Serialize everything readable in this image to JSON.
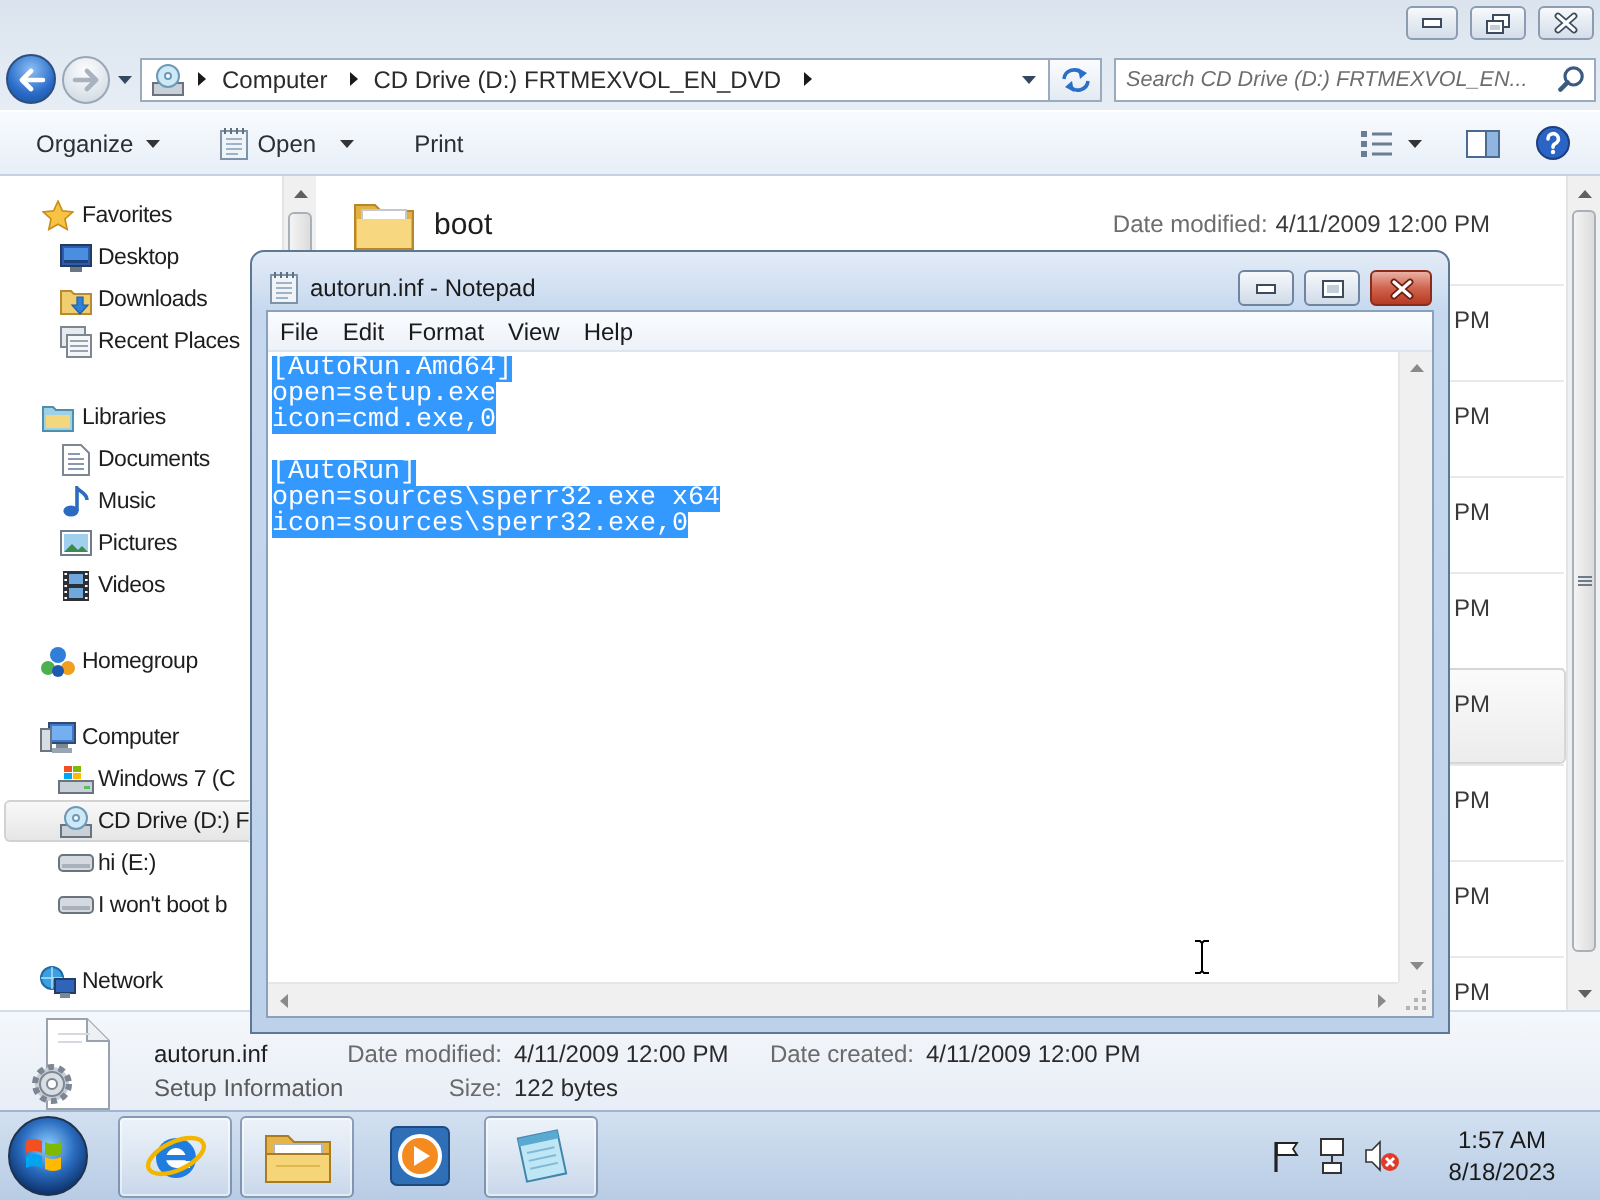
{
  "explorer": {
    "history": {
      "back_disabled": false,
      "forward_disabled": true
    },
    "breadcrumbs": [
      "Computer",
      "CD Drive (D:) FRTMEXVOL_EN_DVD"
    ],
    "search": {
      "placeholder": "Search CD Drive (D:) FRTMEXVOL_EN..."
    },
    "toolbar": [
      {
        "label": "Organize",
        "kind": "menu"
      },
      {
        "label": "Open",
        "kind": "icon-menu"
      },
      {
        "label": "Print",
        "kind": "command"
      }
    ],
    "nav_pane": [
      {
        "label": "Favorites",
        "selected": false,
        "children": [
          {
            "label": "Desktop",
            "selected": false
          },
          {
            "label": "Downloads",
            "selected": false
          },
          {
            "label": "Recent Places",
            "selected": false
          }
        ]
      },
      {
        "label": "Libraries",
        "selected": false,
        "children": [
          {
            "label": "Documents",
            "selected": false
          },
          {
            "label": "Music",
            "selected": false
          },
          {
            "label": "Pictures",
            "selected": false
          },
          {
            "label": "Videos",
            "selected": false
          }
        ]
      },
      {
        "label": "Homegroup",
        "selected": false
      },
      {
        "label": "Computer",
        "selected": false,
        "children": [
          {
            "label": "Windows 7 (C",
            "selected": false
          },
          {
            "label": "CD Drive (D:) F",
            "selected": true
          },
          {
            "label": "hi (E:)",
            "selected": false
          },
          {
            "label": "I won't boot b",
            "selected": false
          }
        ]
      },
      {
        "label": "Network",
        "selected": false
      }
    ],
    "files": [
      {
        "name": "boot",
        "date_label": "Date modified:",
        "date": "4/11/2009 12:00 PM",
        "hovered": false
      },
      {
        "date": "PM",
        "hovered": false
      },
      {
        "date": "PM",
        "hovered": false
      },
      {
        "date": "PM",
        "hovered": false
      },
      {
        "date": "PM",
        "hovered": false
      },
      {
        "date": "PM",
        "hovered": true
      },
      {
        "date": "PM",
        "hovered": false
      },
      {
        "date": "PM",
        "hovered": false
      },
      {
        "date": "PM",
        "hovered": false
      }
    ],
    "details": {
      "name": "autorun.inf",
      "type": "Setup Information",
      "fields": [
        {
          "label": "Date modified:",
          "value": "4/11/2009 12:00 PM"
        },
        {
          "label": "Date created:",
          "value": "4/11/2009 12:00 PM"
        },
        {
          "label": "Size:",
          "value": "122 bytes"
        }
      ]
    }
  },
  "notepad": {
    "title": "autorun.inf - Notepad",
    "menu": [
      "File",
      "Edit",
      "Format",
      "View",
      "Help"
    ],
    "text": "[AutoRun.Amd64]\nopen=setup.exe\nicon=cmd.exe,0\n\n[AutoRun]\nopen=sources\\sperr32.exe x64\nicon=sources\\sperr32.exe,0",
    "text_selected": true
  },
  "taskbar": {
    "apps": [
      {
        "running": true
      },
      {
        "running": true
      },
      {
        "running": false
      },
      {
        "running": true
      }
    ],
    "tray": {
      "volume_muted": true
    },
    "clock": {
      "time": "1:57 AM",
      "date": "8/18/2023"
    }
  }
}
